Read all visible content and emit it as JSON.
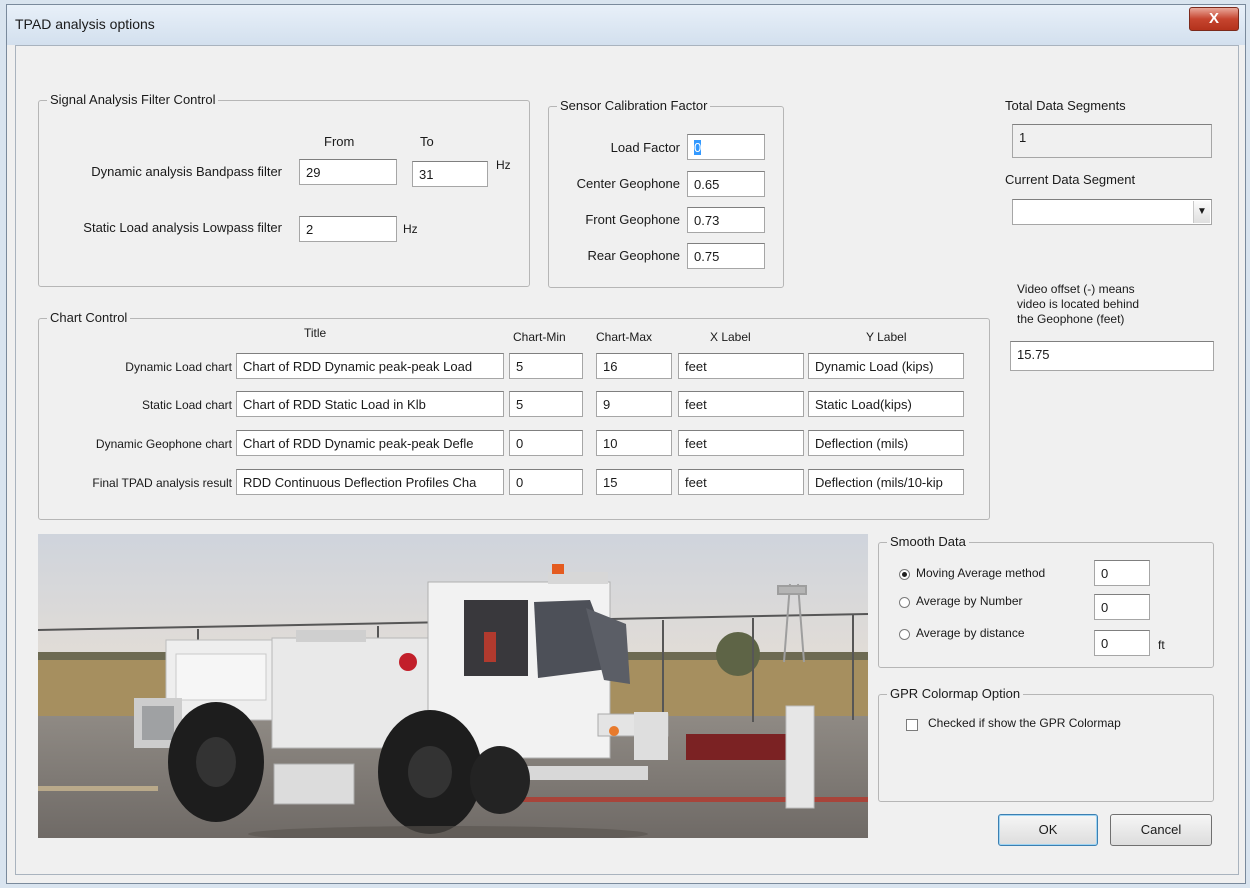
{
  "window": {
    "title": "TPAD analysis options",
    "close_label": "X"
  },
  "signal_filter": {
    "group_label": "Signal Analysis Filter Control",
    "from_header": "From",
    "to_header": "To",
    "dynamic_label": "Dynamic analysis Bandpass filter",
    "dynamic_from": "29",
    "dynamic_to": "31",
    "dynamic_unit": "Hz",
    "static_label": "Static Load analysis Lowpass filter",
    "static_value": "2",
    "static_unit": "Hz"
  },
  "sensor_calibration": {
    "group_label": "Sensor Calibration Factor",
    "load_factor_label": "Load Factor",
    "load_factor": "0",
    "center_label": "Center Geophone",
    "center": "0.65",
    "front_label": "Front Geophone",
    "front": "0.73",
    "rear_label": "Rear Geophone",
    "rear": "0.75"
  },
  "segments": {
    "total_label": "Total Data Segments",
    "total_value": "1",
    "current_label": "Current Data Segment",
    "current_value": ""
  },
  "video_offset": {
    "label_line1": "Video offset  (-) means",
    "label_line2": "video is located behind",
    "label_line3": "the Geophone (feet)",
    "value": "15.75"
  },
  "chart_control": {
    "group_label": "Chart Control",
    "headers": {
      "title": "Title",
      "min": "Chart-Min",
      "max": "Chart-Max",
      "xlabel": "X Label",
      "ylabel": "Y Label"
    },
    "rows": [
      {
        "label": "Dynamic Load chart",
        "title": "Chart of RDD Dynamic peak-peak Load",
        "min": "5",
        "max": "16",
        "xlabel": "feet",
        "ylabel": "Dynamic Load (kips)"
      },
      {
        "label": "Static Load chart",
        "title": "Chart of RDD Static Load in Klb",
        "min": "5",
        "max": "9",
        "xlabel": "feet",
        "ylabel": "Static Load(kips)"
      },
      {
        "label": "Dynamic Geophone chart",
        "title": "Chart of RDD Dynamic peak-peak Defle",
        "min": "0",
        "max": "10",
        "xlabel": "feet",
        "ylabel": "Deflection (mils)"
      },
      {
        "label": "Final TPAD analysis result",
        "title": "RDD Continuous Deflection Profiles Cha",
        "min": "0",
        "max": "15",
        "xlabel": "feet",
        "ylabel": "Deflection (mils/10-kip"
      }
    ]
  },
  "smooth_data": {
    "group_label": "Smooth Data",
    "moving_avg_label": "Moving Average method",
    "moving_avg_value": "0",
    "avg_number_label": "Average by Number",
    "avg_number_value": "0",
    "avg_distance_label": "Average by distance",
    "avg_distance_value": "0",
    "avg_distance_unit": "ft"
  },
  "gpr": {
    "group_label": "GPR Colormap Option",
    "checkbox_label": "Checked if show the GPR Colormap"
  },
  "buttons": {
    "ok": "OK",
    "cancel": "Cancel"
  }
}
